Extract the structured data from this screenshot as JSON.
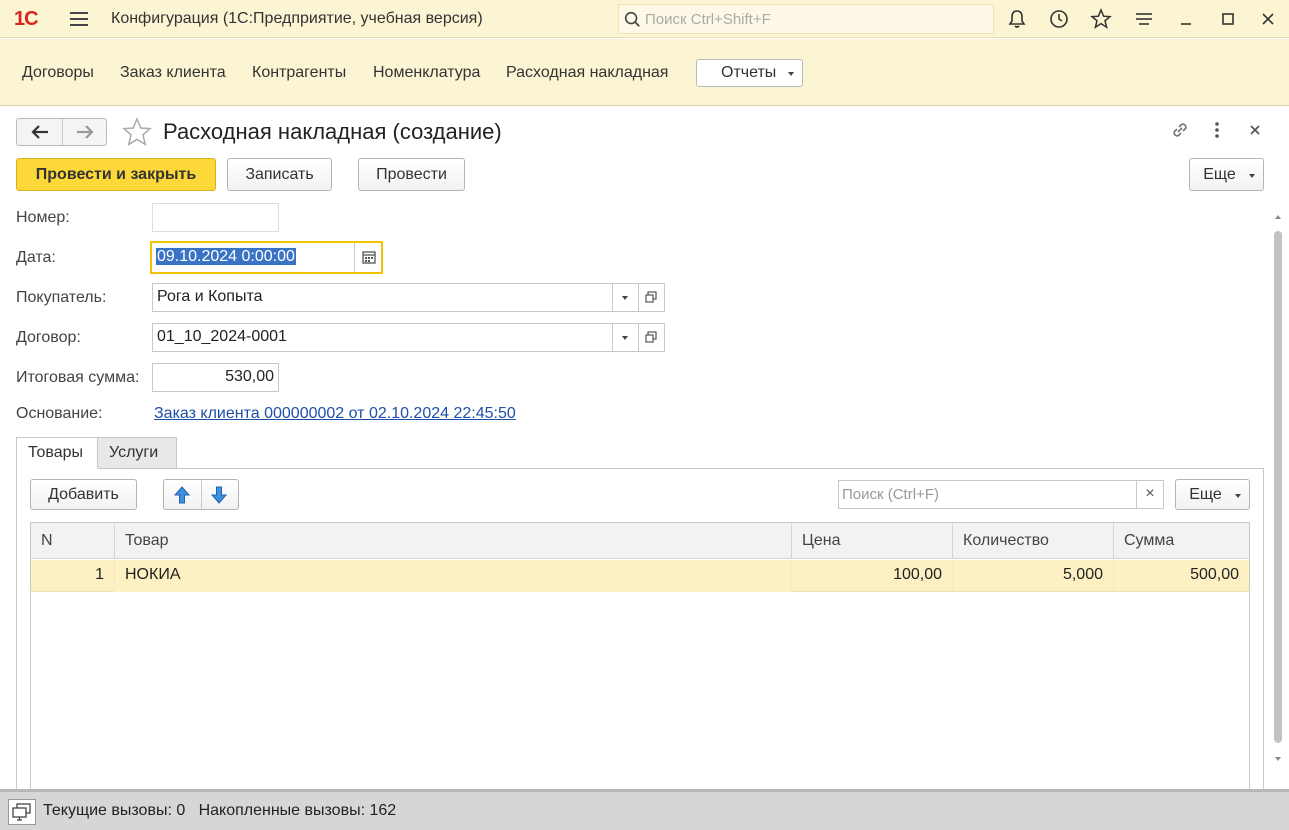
{
  "titlebar": {
    "logo": "1С",
    "title": "Конфигурация  (1С:Предприятие, учебная версия)",
    "search_placeholder": "Поиск Ctrl+Shift+F"
  },
  "menu": {
    "items": [
      "Договоры",
      "Заказ клиента",
      "Контрагенты",
      "Номенклатура",
      "Расходная накладная"
    ],
    "reports_label": "Отчеты"
  },
  "form": {
    "title": "Расходная накладная (создание)",
    "buttons": {
      "post_close": "Провести и закрыть",
      "save": "Записать",
      "post": "Провести",
      "more": "Еще"
    },
    "fields": {
      "number_label": "Номер:",
      "number_value": "",
      "date_label": "Дата:",
      "date_value": "09.10.2024  0:00:00",
      "buyer_label": "Покупатель:",
      "buyer_value": "Рога и Копыта",
      "contract_label": "Договор:",
      "contract_value": "01_10_2024-0001",
      "total_label": "Итоговая сумма:",
      "total_value": "530,00",
      "basis_label": "Основание:",
      "basis_link": "Заказ клиента 000000002 от 02.10.2024 22:45:50"
    },
    "tabs": [
      "Товары",
      "Услуги"
    ],
    "table_toolbar": {
      "add_label": "Добавить",
      "search_placeholder": "Поиск (Ctrl+F)",
      "more": "Еще"
    },
    "table": {
      "columns": [
        "N",
        "Товар",
        "Цена",
        "Количество",
        "Сумма"
      ],
      "rows": [
        {
          "n": "1",
          "product": "НОКИА",
          "price": "100,00",
          "qty": "5,000",
          "sum": "500,00"
        }
      ]
    }
  },
  "statusbar": {
    "text": "Текущие вызовы: 0   Накопленные вызовы: 162"
  }
}
